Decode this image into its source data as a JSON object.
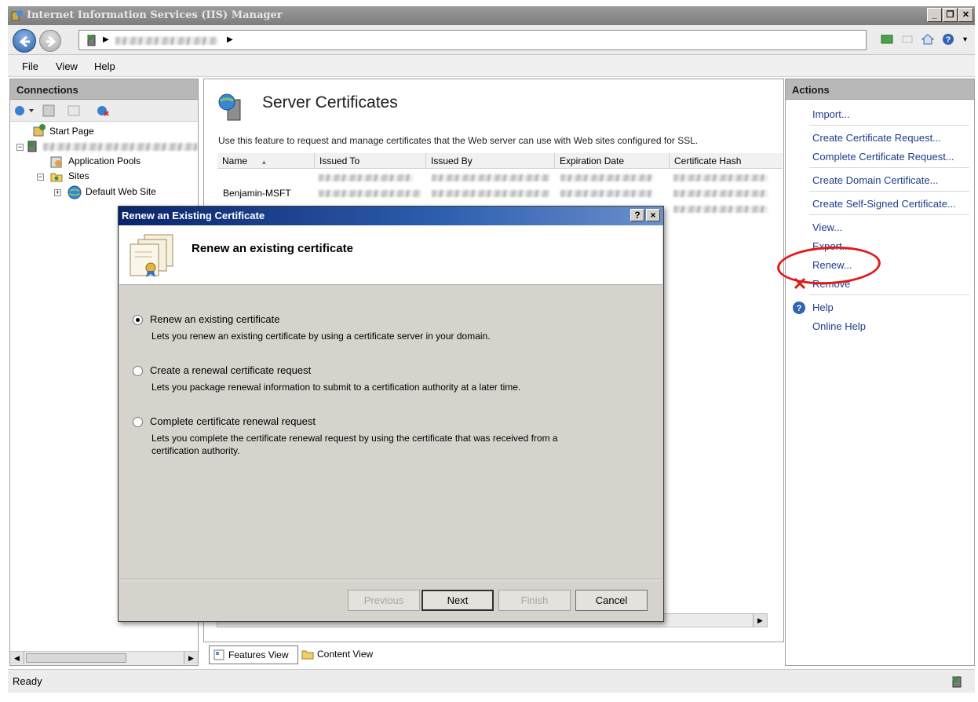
{
  "window": {
    "title": "Internet Information Services (IIS) Manager"
  },
  "menu": [
    "File",
    "View",
    "Help"
  ],
  "connections": {
    "header": "Connections",
    "tree": {
      "start_page": "Start Page",
      "app_pools": "Application Pools",
      "sites": "Sites",
      "default_site": "Default Web Site"
    }
  },
  "feature": {
    "title": "Server Certificates",
    "description": "Use this feature to request and manage certificates that the Web server can use with Web sites configured for SSL.",
    "columns": [
      "Name",
      "Issued To",
      "Issued By",
      "Expiration Date",
      "Certificate Hash"
    ],
    "sort_indicator": "▲",
    "rows": [
      {
        "name": "Benjamin-MSFT"
      }
    ]
  },
  "view_tabs": {
    "features": "Features View",
    "content": "Content View"
  },
  "actions": {
    "header": "Actions",
    "import": "Import...",
    "create_request": "Create Certificate Request...",
    "complete_request": "Complete Certificate Request...",
    "create_domain": "Create Domain Certificate...",
    "create_self_signed": "Create Self-Signed Certificate...",
    "view": "View...",
    "export": "Export...",
    "renew": "Renew...",
    "remove": "Remove",
    "help": "Help",
    "online_help": "Online Help",
    "highlight_color": "#e11b1b"
  },
  "dialog": {
    "title": "Renew an Existing Certificate",
    "heading": "Renew an existing certificate",
    "help_glyph": "?",
    "close_glyph": "×",
    "options": [
      {
        "label": "Renew an existing certificate",
        "description": "Lets you renew an existing certificate by using a certificate server in your domain.",
        "checked": true
      },
      {
        "label": "Create a renewal certificate request",
        "description": "Lets you package renewal information to submit to a certification authority at a later time.",
        "checked": false
      },
      {
        "label": "Complete certificate renewal request",
        "description": "Lets you complete the certificate renewal request by using the certificate that was received from a certification authority.",
        "checked": false
      }
    ],
    "buttons": {
      "previous": "Previous",
      "next": "Next",
      "finish": "Finish",
      "cancel": "Cancel"
    }
  },
  "status": {
    "text": "Ready"
  },
  "colors": {
    "dialog_title": "#0a246a",
    "link": "#1c3c8c"
  },
  "icons": [
    "iis-app-icon",
    "back-arrow-icon",
    "forward-arrow-icon",
    "server-icon",
    "certificate-icon",
    "help-icon",
    "remove-x-icon"
  ]
}
